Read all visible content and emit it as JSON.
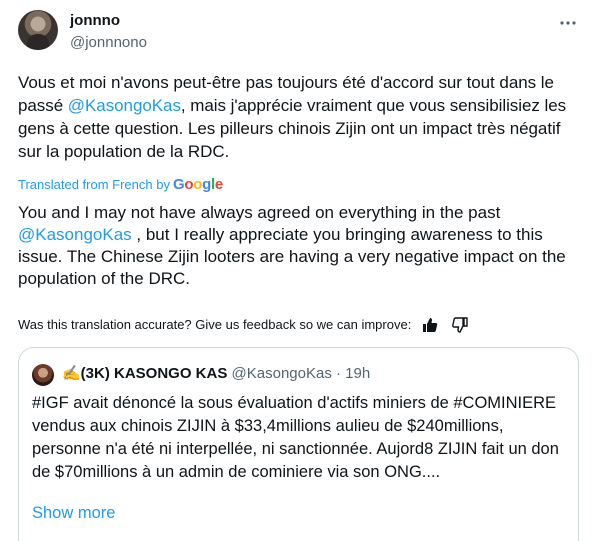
{
  "author": {
    "display_name": "jonnno",
    "handle": "@jonnnono"
  },
  "tweet": {
    "original_part1": "Vous et moi n'avons peut-être pas toujours été d'accord sur tout dans le passé ",
    "original_mention": "@KasongoKas",
    "original_part2": ", mais j'apprécie vraiment que vous sensibilisiez les gens à cette question. Les pilleurs chinois Zijin ont un impact très négatif sur la population de la RDC.",
    "translated_from": "Translated from French by",
    "google": "Google",
    "translation_part1": "You and I may not have always agreed on everything in the past ",
    "translation_mention": "@KasongoKas",
    "translation_part2": " , but I really appreciate you bringing awareness to this issue. The Chinese Zijin looters are having a very negative impact on the population of the DRC."
  },
  "feedback": {
    "prompt": "Was this translation accurate? Give us feedback so we can improve:",
    "thumbs_up_icon": "thumbs-up-icon",
    "thumbs_down_icon": "thumbs-down-icon"
  },
  "quote": {
    "name": "✍️(3K) KASONGO KAS",
    "handle_time": "@KasongoKas · 19h",
    "text": "#IGF avait dénoncé la sous évaluation d'actifs miniers de #COMINIERE vendus aux chinois ZIJIN à $33,4millions aulieu de $240millions, personne n'a été ni interpellée, ni sanctionnée. Aujord8 ZIJIN fait un don de $70millions à un admin de cominiere via son ONG....",
    "show_more": "Show more"
  },
  "colors": {
    "accent": "#1d9bf0",
    "secondary_text": "#536471",
    "border": "#cfd9de"
  }
}
